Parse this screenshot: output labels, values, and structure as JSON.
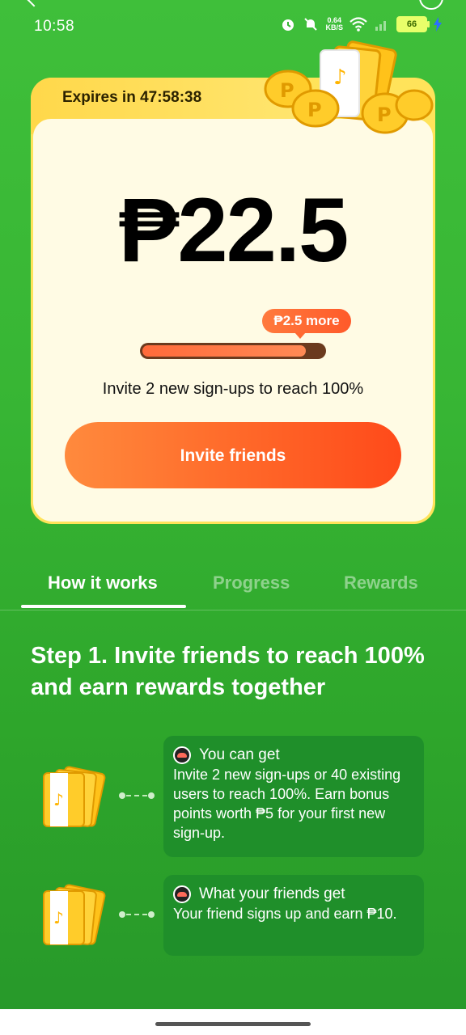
{
  "status_bar": {
    "time": "10:58",
    "speed_value": "0.64",
    "speed_unit": "KB/S",
    "battery": "66"
  },
  "offer": {
    "expires_label": "Expires in 47:58:38",
    "amount": "₱22.5",
    "tooltip": "₱2.5 more",
    "progress_fraction": 0.9,
    "hint": "Invite 2 new sign-ups to reach 100%",
    "invite_button": "Invite friends"
  },
  "tabs": [
    {
      "label": "How it works",
      "active": true
    },
    {
      "label": "Progress",
      "active": false
    },
    {
      "label": "Rewards",
      "active": false
    }
  ],
  "step": {
    "title": "Step 1. Invite friends to reach 100% and earn rewards together",
    "items": [
      {
        "heading": "You can get",
        "body": "Invite 2 new sign-ups or 40 existing users to reach 100%. Earn bonus points worth ₱5 for your first new sign-up."
      },
      {
        "heading": "What your friends get",
        "body": "Your friend signs up and earn ₱10."
      }
    ]
  },
  "colors": {
    "background": "#37b534",
    "card": "#fffbe4",
    "accent_orange": "#ff6a2a",
    "info_box": "#1f8f2a"
  }
}
